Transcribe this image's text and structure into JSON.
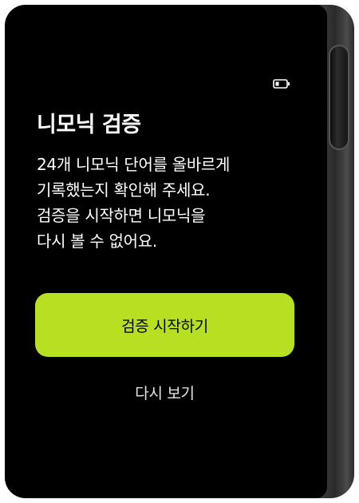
{
  "status": {
    "battery_icon": "battery-low-icon"
  },
  "screen": {
    "title": "니모닉 검증",
    "description_lines": [
      "24개 니모닉 단어를 올바르게",
      "기록했는지 확인해 주세요.",
      "검증을 시작하면 니모닉을",
      "다시 볼 수 없어요."
    ],
    "primary_button": "검증 시작하기",
    "secondary_button": "다시 보기"
  },
  "colors": {
    "background": "#000000",
    "accent": "#b6e021",
    "text": "#ffffff"
  }
}
